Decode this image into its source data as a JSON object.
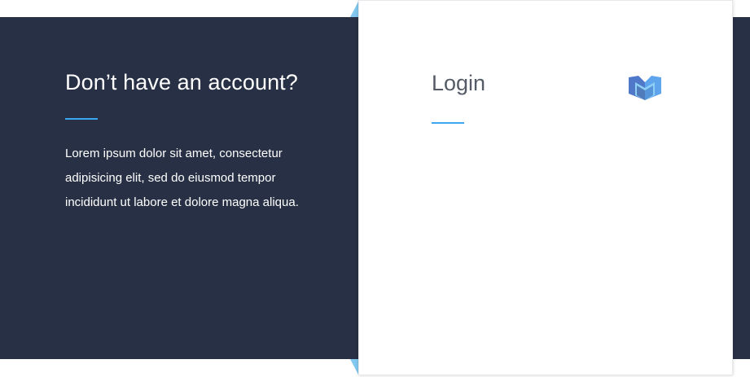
{
  "signup": {
    "title": "Don’t have an account?",
    "body": "Lorem ipsum dolor sit amet, consectetur adipisicing elit, sed do eiusmod tempor incididunt ut labore et dolore magna aliqua."
  },
  "login": {
    "title": "Login",
    "logo_icon": "m-logo-icon"
  },
  "colors": {
    "dark_background": "#273044",
    "accent_blue": "#3ea6ee",
    "light_blue": "#82c8ef",
    "card_background": "#ffffff"
  }
}
